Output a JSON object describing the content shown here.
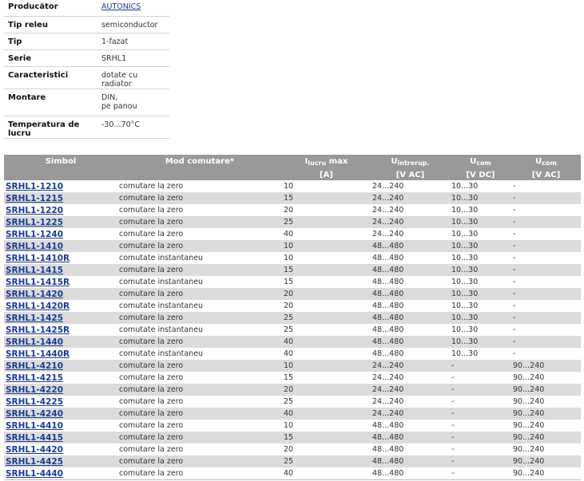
{
  "specs": [
    {
      "key": "Producător",
      "value": "AUTONICS",
      "link": true
    },
    {
      "key": "Tip releu",
      "value": "semiconductor"
    },
    {
      "key": "Tip",
      "value": "1-fazat"
    },
    {
      "key": "Serie",
      "value": "SRHL1"
    },
    {
      "key": "Caracteristici",
      "value": "dotate cu radiator"
    },
    {
      "key": "Montare",
      "value": "DIN,",
      "value2": "pe panou"
    },
    {
      "key": "Temperatura de lucru",
      "value": "-30...70°C"
    }
  ],
  "table": {
    "headers": {
      "symbol": "Simbol",
      "mode": "Mod comutare*",
      "i_main": "I",
      "i_sub": "lucru",
      "i_suffix": " max",
      "i_unit": "[A]",
      "uint_main": "U",
      "uint_sub": "întrerup.",
      "uint_unit": "[V AC]",
      "ucdc_main": "U",
      "ucdc_sub": "com",
      "ucdc_unit": "[V DC]",
      "ucac_main": "U",
      "ucac_sub": "com",
      "ucac_unit": "[V AC]"
    },
    "rows": [
      [
        "SRHL1-1210",
        "comutare la zero",
        "10",
        "24...240",
        "10...30",
        "-"
      ],
      [
        "SRHL1-1215",
        "comutare la zero",
        "15",
        "24...240",
        "10...30",
        "-"
      ],
      [
        "SRHL1-1220",
        "comutare la zero",
        "20",
        "24...240",
        "10...30",
        "-"
      ],
      [
        "SRHL1-1225",
        "comutare la zero",
        "25",
        "24...240",
        "10...30",
        "-"
      ],
      [
        "SRHL1-1240",
        "comutare la zero",
        "40",
        "24...240",
        "10...30",
        "-"
      ],
      [
        "SRHL1-1410",
        "comutare la zero",
        "10",
        "48...480",
        "10...30",
        "-"
      ],
      [
        "SRHL1-1410R",
        "comutate instantaneu",
        "10",
        "48...480",
        "10...30",
        "-"
      ],
      [
        "SRHL1-1415",
        "comutare la zero",
        "15",
        "48...480",
        "10...30",
        "-"
      ],
      [
        "SRHL1-1415R",
        "comutate instantaneu",
        "15",
        "48...480",
        "10...30",
        "-"
      ],
      [
        "SRHL1-1420",
        "comutare la zero",
        "20",
        "48...480",
        "10...30",
        "-"
      ],
      [
        "SRHL1-1420R",
        "comutate instantaneu",
        "20",
        "48...480",
        "10...30",
        "-"
      ],
      [
        "SRHL1-1425",
        "comutare la zero",
        "25",
        "48...480",
        "10...30",
        "-"
      ],
      [
        "SRHL1-1425R",
        "comutate instantaneu",
        "25",
        "48...480",
        "10...30",
        "-"
      ],
      [
        "SRHL1-1440",
        "comutare la zero",
        "40",
        "48...480",
        "10...30",
        "-"
      ],
      [
        "SRHL1-1440R",
        "comutate instantaneu",
        "40",
        "48...480",
        "10...30",
        "-"
      ],
      [
        "SRHL1-4210",
        "comutare la zero",
        "10",
        "24...240",
        "-",
        "90...240"
      ],
      [
        "SRHL1-4215",
        "comutare la zero",
        "15",
        "24...240",
        "-",
        "90...240"
      ],
      [
        "SRHL1-4220",
        "comutare la zero",
        "20",
        "24...240",
        "-",
        "90...240"
      ],
      [
        "SRHL1-4225",
        "comutare la zero",
        "25",
        "24...240",
        "-",
        "90...240"
      ],
      [
        "SRHL1-4240",
        "comutare la zero",
        "40",
        "24...240",
        "-",
        "90...240"
      ],
      [
        "SRHL1-4410",
        "comutare la zero",
        "10",
        "48...480",
        "-",
        "90...240"
      ],
      [
        "SRHL1-4415",
        "comutare la zero",
        "15",
        "48...480",
        "-",
        "90...240"
      ],
      [
        "SRHL1-4420",
        "comutare la zero",
        "20",
        "48...480",
        "-",
        "90...240"
      ],
      [
        "SRHL1-4425",
        "comutare la zero",
        "25",
        "48...480",
        "-",
        "90...240"
      ],
      [
        "SRHL1-4440",
        "comutare la zero",
        "40",
        "48...480",
        "-",
        "90...240"
      ]
    ]
  },
  "colors": {
    "header_bg": "#999999",
    "row_alt": "#dcdcdc",
    "link": "#1a3d8f"
  }
}
